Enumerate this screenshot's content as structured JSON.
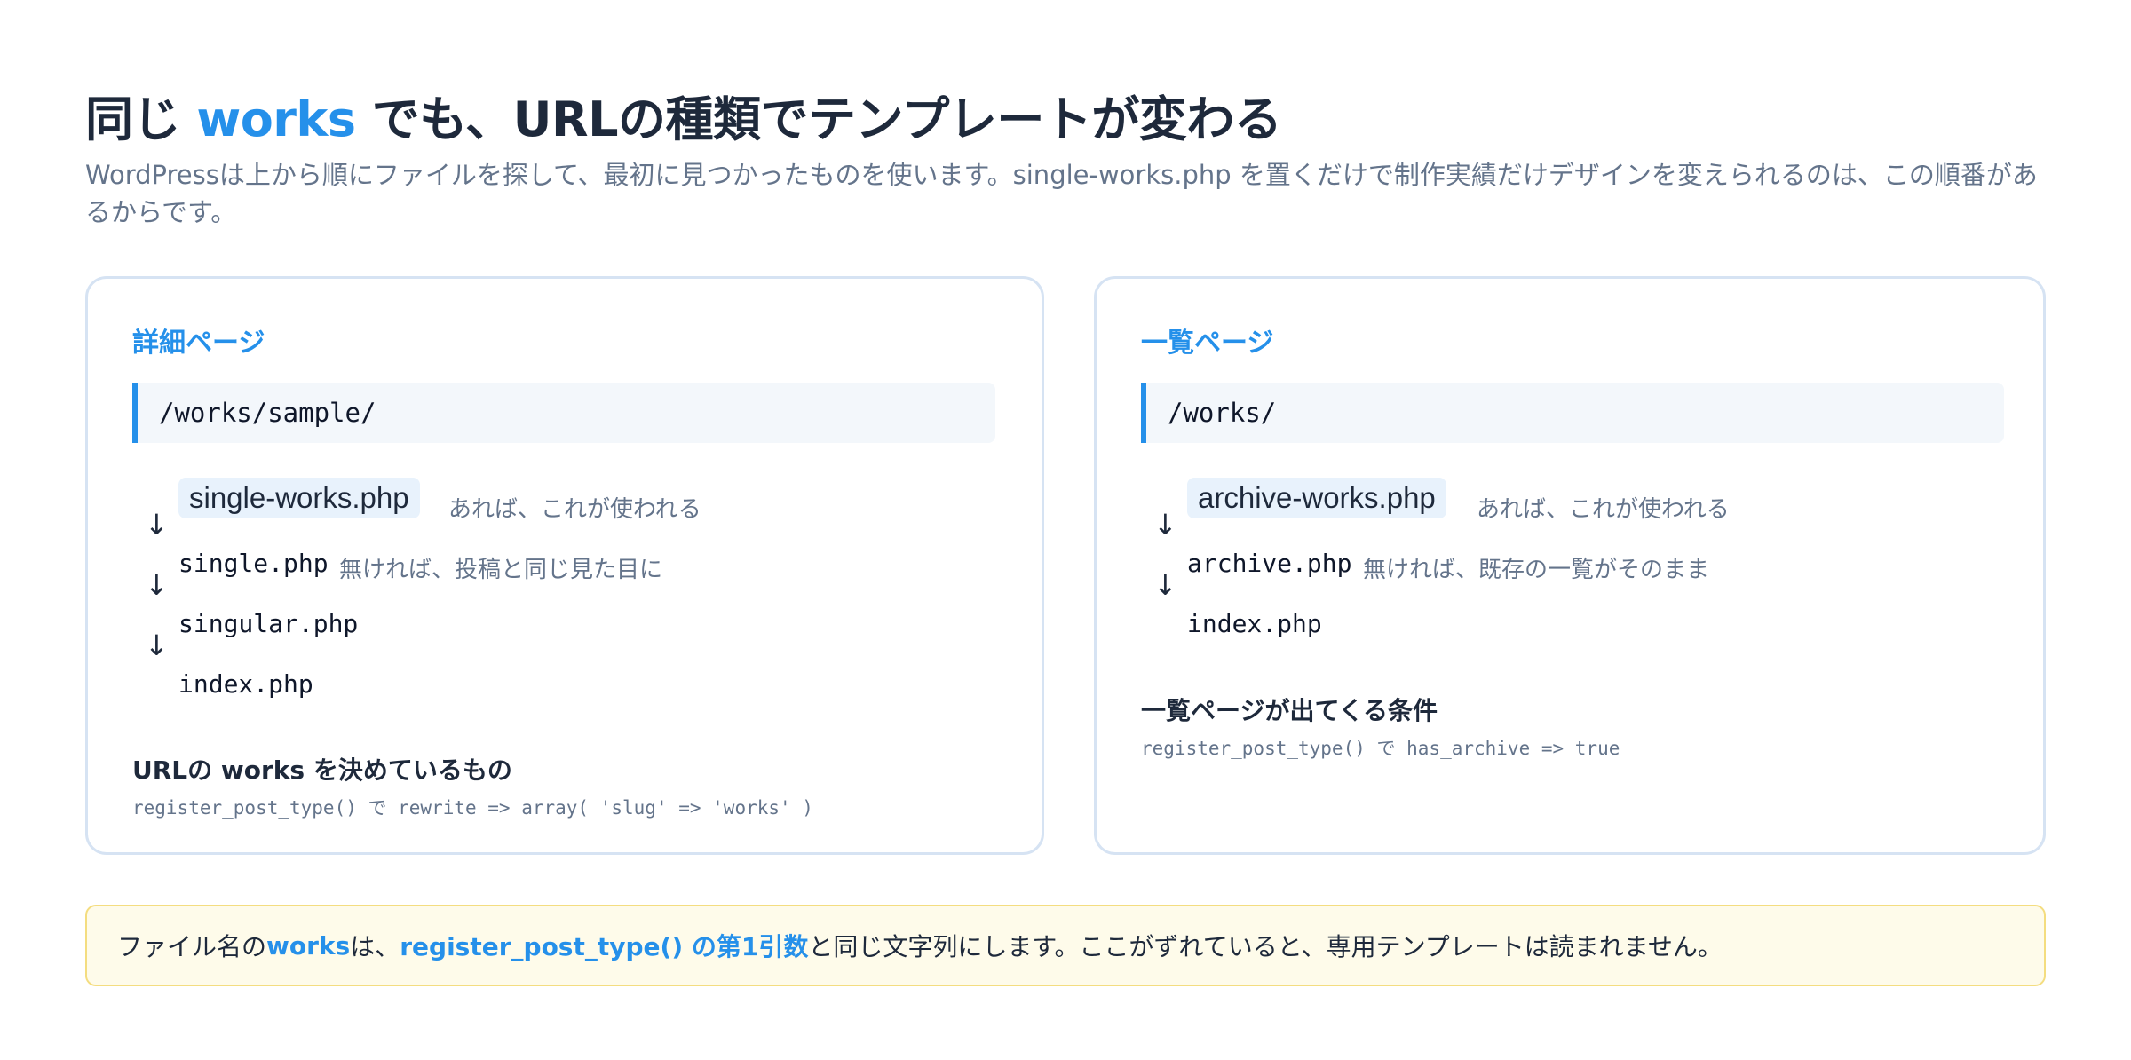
{
  "header": {
    "title_before": "同じ ",
    "title_accent": "works",
    "title_after": " でも、URLの種類でテンプレートが変わる",
    "lead": "WordPressは上から順にファイルを探して、最初に見つかったものを使います。single-works.php を置くだけで制作実績だけデザインを変えられるのは、この順番があるからです。"
  },
  "detail_card": {
    "title": "詳細ページ",
    "url": "/works/sample/",
    "steps": [
      {
        "file": "single-works.php",
        "note": "あれば、これが使われる"
      },
      {
        "file": "single.php",
        "note": "無ければ、投稿と同じ見た目に"
      },
      {
        "file": "singular.php",
        "note": ""
      },
      {
        "file": "index.php",
        "note": ""
      }
    ],
    "arrow": "↓",
    "condition_title": "URLの works を決めているもの",
    "condition_code": "register_post_type() で rewrite => array( 'slug' => 'works' )"
  },
  "archive_card": {
    "title": "一覧ページ",
    "url": "/works/",
    "steps": [
      {
        "file": "archive-works.php",
        "note": "あれば、これが使われる"
      },
      {
        "file": "archive.php",
        "note": "無ければ、既存の一覧がそのまま"
      },
      {
        "file": "index.php",
        "note": ""
      }
    ],
    "arrow": "↓",
    "condition_title": "一覧ページが出てくる条件",
    "condition_code": "register_post_type() で has_archive => true"
  },
  "callout": {
    "part1": "ファイル名の ",
    "em1": "works",
    "part2": " は、",
    "em2": "register_post_type() の第1引数",
    "part3": "と同じ文字列にします。ここがずれていると、専用テンプレートは読まれません。"
  },
  "colors": {
    "accent": "#2590ea",
    "card_border": "#d6e3f3",
    "callout_bg": "#fefbea",
    "callout_border": "#f4dd80"
  }
}
